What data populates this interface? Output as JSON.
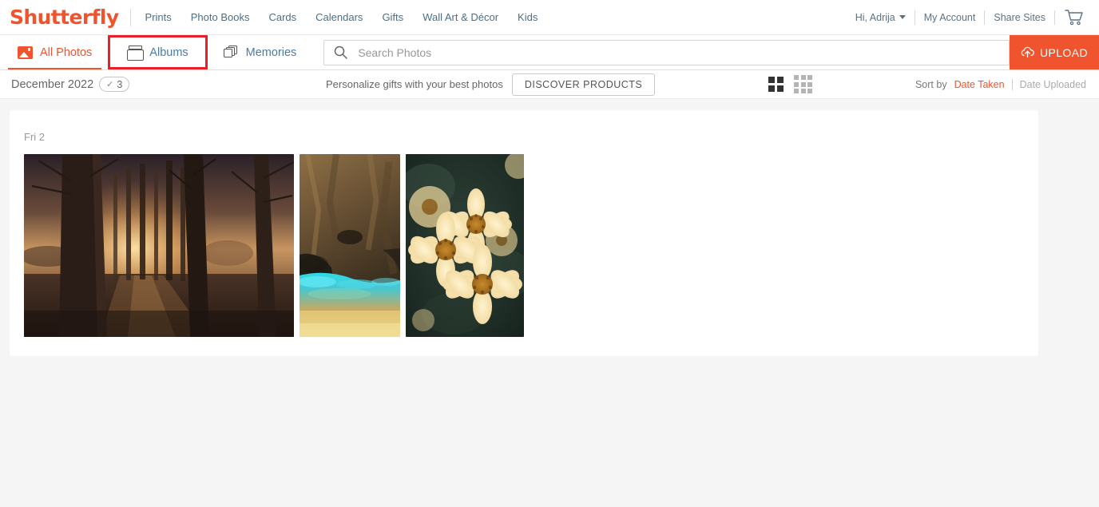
{
  "brand": {
    "name": "Shutterfly"
  },
  "main_nav": [
    {
      "label": "Prints"
    },
    {
      "label": "Photo Books"
    },
    {
      "label": "Cards"
    },
    {
      "label": "Calendars"
    },
    {
      "label": "Gifts"
    },
    {
      "label": "Wall Art & Décor"
    },
    {
      "label": "Kids"
    }
  ],
  "account_nav": {
    "greeting": "Hi, Adrija",
    "my_account": "My Account",
    "share_sites": "Share Sites",
    "cart_icon": "shopping-cart-icon"
  },
  "tabs": [
    {
      "label": "All Photos",
      "icon": "photo-icon",
      "active": true,
      "highlighted": false
    },
    {
      "label": "Albums",
      "icon": "album-icon",
      "active": false,
      "highlighted": true
    },
    {
      "label": "Memories",
      "icon": "memories-stack-icon",
      "active": false,
      "highlighted": false
    }
  ],
  "search": {
    "placeholder": "Search Photos",
    "value": "",
    "icon": "search-icon"
  },
  "upload": {
    "label": "UPLOAD",
    "icon": "cloud-upload-icon",
    "color": "#f0542e"
  },
  "toolbar": {
    "month": "December 2022",
    "selected_count": "3",
    "check_icon": "check-icon",
    "promo_text": "Personalize gifts with your best photos",
    "promo_button": "DISCOVER PRODUCTS",
    "view_large_icon": "grid-2x2-icon",
    "view_small_icon": "grid-3x3-icon",
    "sort_label": "Sort by",
    "sort_options": [
      {
        "label": "Date Taken",
        "active": true
      },
      {
        "label": "Date Uploaded",
        "active": false
      }
    ]
  },
  "gallery": {
    "group_date": "Fri 2",
    "photos": [
      {
        "name": "misty-forest-sunset",
        "orientation": "landscape"
      },
      {
        "name": "cave-turquoise-water",
        "orientation": "portrait"
      },
      {
        "name": "yellow-flowers",
        "orientation": "portrait"
      }
    ]
  },
  "colors": {
    "brand_orange": "#f0542e",
    "link_blue": "#4a7ba7",
    "annotation_red": "#e8202a",
    "page_bg": "#f5f5f5"
  }
}
